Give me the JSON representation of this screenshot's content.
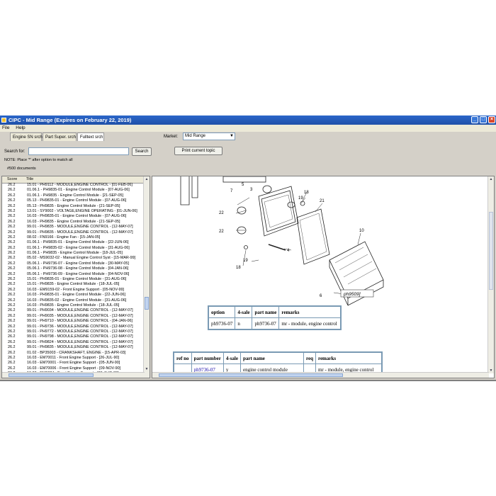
{
  "window": {
    "title": "CIPC - Mid Range (Expires on February 22, 2019)",
    "controls": [
      "minimize",
      "maximize",
      "close"
    ]
  },
  "menu": [
    "File",
    "Help"
  ],
  "tabs": [
    {
      "label": "Engine SN srch",
      "active": false
    },
    {
      "label": "Part Super. srch",
      "active": false
    },
    {
      "label": "Fulltext srch",
      "active": true
    }
  ],
  "market": {
    "label": "Market:",
    "value": "Mid Range"
  },
  "search": {
    "label": "Search for:",
    "value": "",
    "button": "Search"
  },
  "print_button": "Print current topic",
  "note": "NOTE: Place '*' after option to match all",
  "document_count": "#500 documents",
  "results": {
    "columns": [
      "Score",
      "Title"
    ],
    "rows": [
      {
        "score": "26.2",
        "title": "15.01 - PH9112 - MODULE,ENGINE CONTROL - [01-FEB-06]"
      },
      {
        "score": "26.2",
        "title": "01.06.1 - PH9835-01 - Engine Control Module - [07-AUG-06]"
      },
      {
        "score": "26.2",
        "title": "01.06.1 - PH9835 - Engine Control Module - [21-SEP-05]"
      },
      {
        "score": "26.2",
        "title": "05.13 - PH9835-01 - Engine Control Module - [07-AUG-06]"
      },
      {
        "score": "26.2",
        "title": "05.13 - PH9835 - Engine Control Module - [21-SEP-05]"
      },
      {
        "score": "26.2",
        "title": "13.01 - SY9002 - VOLTAGE,ENGINE OPERATING - [01-JUN-06]"
      },
      {
        "score": "26.2",
        "title": "16.03 - PH9835-01 - Engine Control Module - [07-AUG-06]"
      },
      {
        "score": "26.2",
        "title": "16.03 - PH9835 - Engine Control Module - [21-SEP-05]"
      },
      {
        "score": "26.2",
        "title": "99.01 - PH9835 - MODULE,ENGINE CONTROL - [12-MAY-07]"
      },
      {
        "score": "26.2",
        "title": "99.01 - PH9835 - MODULE,ENGINE CONTROL - [12-MAY-07]"
      },
      {
        "score": "26.2",
        "title": "08.02 - FN9166 - Engine Fan - [15-JAN-05]"
      },
      {
        "score": "26.2",
        "title": "01.06.1 - PH9835-01 - Engine Control Module - [22-JUN-06]"
      },
      {
        "score": "26.2",
        "title": "01.06.1 - PH9835-02 - Engine Control Module - [31-AUG-06]"
      },
      {
        "score": "26.2",
        "title": "01.06.1 - PH9835 - Engine Control Module - [18-JUL-05]"
      },
      {
        "score": "26.2",
        "title": "05.02 - MS9032-02 - Manual Engine Control Syst - [15-MAR-99]"
      },
      {
        "score": "26.2",
        "title": "05.06.1 - PH9736-07 - Engine Control Module - [30-MAY-05]"
      },
      {
        "score": "26.2",
        "title": "05.06.1 - PH9736-08 - Engine Control Module - [04-JAN-06]"
      },
      {
        "score": "26.2",
        "title": "05.06.1 - PH9736-09 - Engine Control Module - [04-NOV-06]"
      },
      {
        "score": "26.2",
        "title": "15.01 - PH9835-01 - Engine Control Module - [31-AUG-06]"
      },
      {
        "score": "26.2",
        "title": "15.01 - PH9835 - Engine Control Module - [18-JUL-05]"
      },
      {
        "score": "26.2",
        "title": "16.03 - EM9159-02 - Front Engine Support - [05-NOV-99]"
      },
      {
        "score": "26.2",
        "title": "16.03 - PH9835-01 - Engine Control Module - [22-JUN-06]"
      },
      {
        "score": "26.2",
        "title": "16.03 - PH9835-02 - Engine Control Module - [31-AUG-06]"
      },
      {
        "score": "26.2",
        "title": "16.03 - PH9835 - Engine Control Module - [18-JUL-05]"
      },
      {
        "score": "26.2",
        "title": "99.01 - PH9034 - MODULE,ENGINE CONTROL - [12-MAY-07]"
      },
      {
        "score": "26.2",
        "title": "99.01 - PH9035 - MODULE,ENGINE CONTROL - [12-MAY-07]"
      },
      {
        "score": "26.2",
        "title": "99.01 - PH9710 - MODULE,ENGINE CONTROL - [04-JAN-06]"
      },
      {
        "score": "26.2",
        "title": "99.01 - PH9736 - MODULE,ENGINE CONTROL - [12-MAY-07]"
      },
      {
        "score": "26.2",
        "title": "99.01 - PH9772 - MODULE,ENGINE CONTROL - [12-MAY-07]"
      },
      {
        "score": "26.2",
        "title": "99.01 - PH9798 - MODULE,ENGINE CONTROL - [12-MAY-07]"
      },
      {
        "score": "26.2",
        "title": "99.01 - PH9824 - MODULE,ENGINE CONTROL - [12-MAY-07]"
      },
      {
        "score": "26.2",
        "title": "99.01 - PH9835 - MODULE,ENGINE CONTROL - [12-MAY-07]"
      },
      {
        "score": "26.2",
        "title": "01.02 - BP35003 - CRANKSHAFT, ENGINE - [15-APR-03]"
      },
      {
        "score": "26.2",
        "title": "16.03 - EM70011 - Front Engine Support - [26-JUL-90]"
      },
      {
        "score": "26.2",
        "title": "16.03 - EM70001 - Front Engine Support - [05-JUN-90]"
      },
      {
        "score": "26.2",
        "title": "16.03 - EM70006 - Front Engine Support - [09-NOV-90]"
      },
      {
        "score": "26.2",
        "title": "16.03 - EM9024 - Front Engine Support - [30-AUG-89]"
      }
    ]
  },
  "diagram": {
    "callouts": [
      "5",
      "3",
      "7",
      "18",
      "19",
      "22",
      "21",
      "22",
      "10",
      "4",
      "19",
      "18",
      "6"
    ],
    "figure_label": "ph9509]"
  },
  "option_table": {
    "headers": [
      "option",
      "4-sale",
      "part name",
      "remarks"
    ],
    "rows": [
      [
        "ph9736-07",
        "n",
        "ph9736-07",
        "mr - module, engine control"
      ]
    ]
  },
  "parts_table": {
    "headers": [
      "ref no",
      "part number",
      "4-sale",
      "part name",
      "req",
      "remarks"
    ],
    "rows": [
      [
        "",
        "ph9736-07",
        "y",
        "engine control module",
        "",
        "mr - module, engine control"
      ]
    ]
  }
}
